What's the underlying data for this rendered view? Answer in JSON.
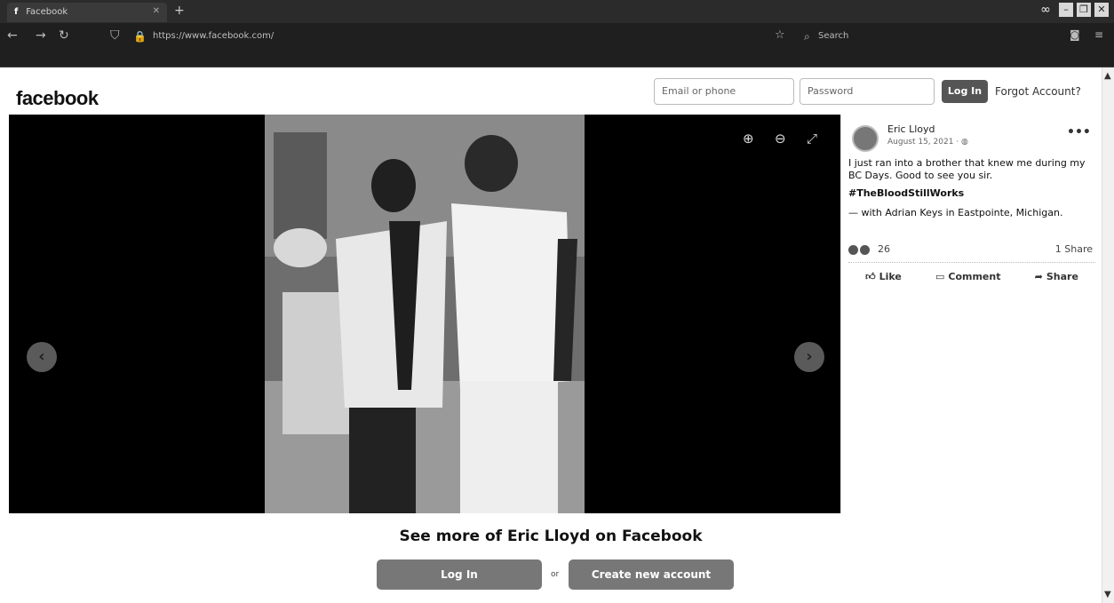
{
  "browser": {
    "tab_title": "Facebook",
    "url": "https://www.facebook.com/",
    "search_placeholder": "Search"
  },
  "header": {
    "logo": "facebook",
    "email_placeholder": "Email or phone",
    "password_placeholder": "Password",
    "login_label": "Log In",
    "forgot_label": "Forgot Account?"
  },
  "post": {
    "author": "Eric Lloyd",
    "date": "August 15, 2021 · ",
    "text": "I just ran into a brother that knew me during my BC Days. Good to see you sir.",
    "hashtag": "#TheBloodStillWorks",
    "with_text": "— with Adrian Keys in Eastpointe, Michigan.",
    "reaction_count": "26",
    "share_count": "1 Share",
    "like_label": "Like",
    "comment_label": "Comment",
    "share_label": "Share"
  },
  "cta": {
    "title": "See more of Eric Lloyd on Facebook",
    "login_label": "Log In",
    "or_label": "or",
    "create_label": "Create new account"
  }
}
